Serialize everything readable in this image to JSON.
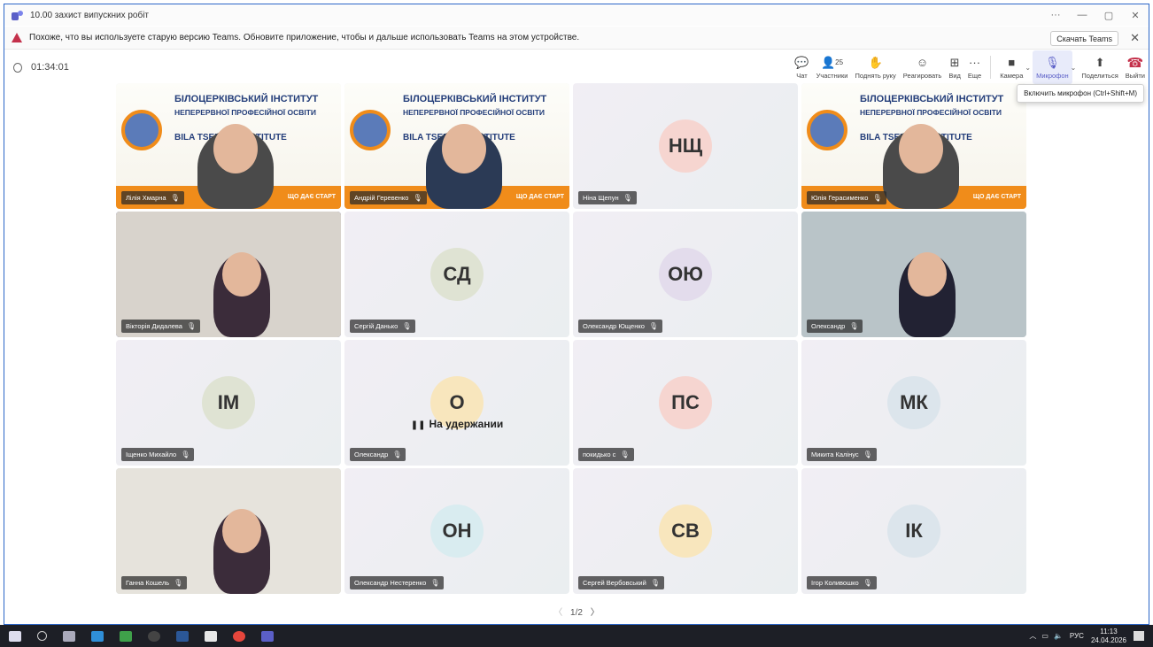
{
  "window": {
    "title": "10.00 захист випускних робіт",
    "controls": [
      "···",
      "—",
      "▢",
      "✕"
    ]
  },
  "banner": {
    "text": "Похоже, что вы используете старую версию Teams. Обновите приложение, чтобы и дальше использовать Teams на этом устройстве.",
    "button": "Скачать Teams"
  },
  "meeting": {
    "timer": "01:34:01",
    "participants_count": "25"
  },
  "toolbar": {
    "chat": "Чат",
    "participants": "Участники",
    "raise_hand": "Поднять руку",
    "react": "Реагировать",
    "view": "Вид",
    "more": "Еще",
    "camera": "Камера",
    "mic": "Микрофон",
    "share": "Поделиться",
    "leave": "Выйти"
  },
  "tooltip": "Включить микрофон (Ctrl+Shift+M)",
  "slide_text": {
    "line1": "БІЛОЦЕРКІВСЬКИЙ ІНСТИТУТ",
    "line2": "НЕПЕРЕРВНОЇ ПРОФЕСІЙНОЇ ОСВІТИ",
    "line3": "BILA TSERKVA INSTITUTE",
    "line4": "ЩО ДАЄ СТАРТ"
  },
  "tiles": [
    {
      "name": "Лілія Хмарна",
      "initials": "",
      "kind": "slide"
    },
    {
      "name": "Андрій Геревенко",
      "initials": "",
      "kind": "slide"
    },
    {
      "name": "Ніна Щепун",
      "initials": "НЩ",
      "kind": "avatar",
      "color": "#f6d5d0"
    },
    {
      "name": "Юлія Герасименко",
      "initials": "",
      "kind": "slide"
    },
    {
      "name": "Вікторія Дидалева",
      "initials": "",
      "kind": "video",
      "active": true
    },
    {
      "name": "Сергій Данько",
      "initials": "СД",
      "kind": "avatar",
      "color": "#dfe3d3"
    },
    {
      "name": "Олександр Ющенко",
      "initials": "ОЮ",
      "kind": "avatar",
      "color": "#e3dcec"
    },
    {
      "name": "Олександр",
      "initials": "",
      "kind": "video"
    },
    {
      "name": "Іщенко Михайло",
      "initials": "ІМ",
      "kind": "avatar",
      "color": "#dfe3d3"
    },
    {
      "name": "Олександр",
      "initials": "О",
      "kind": "avatar",
      "color": "#f8e6bd",
      "hold": "На удержании"
    },
    {
      "name": "покидько с",
      "initials": "ПС",
      "kind": "avatar",
      "color": "#f6d5d0"
    },
    {
      "name": "Микита Калінус",
      "initials": "МК",
      "kind": "avatar",
      "color": "#dce5ec"
    },
    {
      "name": "Ганна Кошель",
      "initials": "",
      "kind": "video"
    },
    {
      "name": "Олександр Нестеренко",
      "initials": "ОН",
      "kind": "avatar",
      "color": "#d9ecf0"
    },
    {
      "name": "Сергей Вербовський",
      "initials": "СВ",
      "kind": "avatar",
      "color": "#f8e6bd"
    },
    {
      "name": "Ігор Коливошко",
      "initials": "ІК",
      "kind": "avatar",
      "color": "#dce5ec"
    }
  ],
  "pager": {
    "text": "1/2"
  },
  "taskbar": {
    "lang": "РУС",
    "time": "11:13",
    "date": "24.04.2026"
  }
}
